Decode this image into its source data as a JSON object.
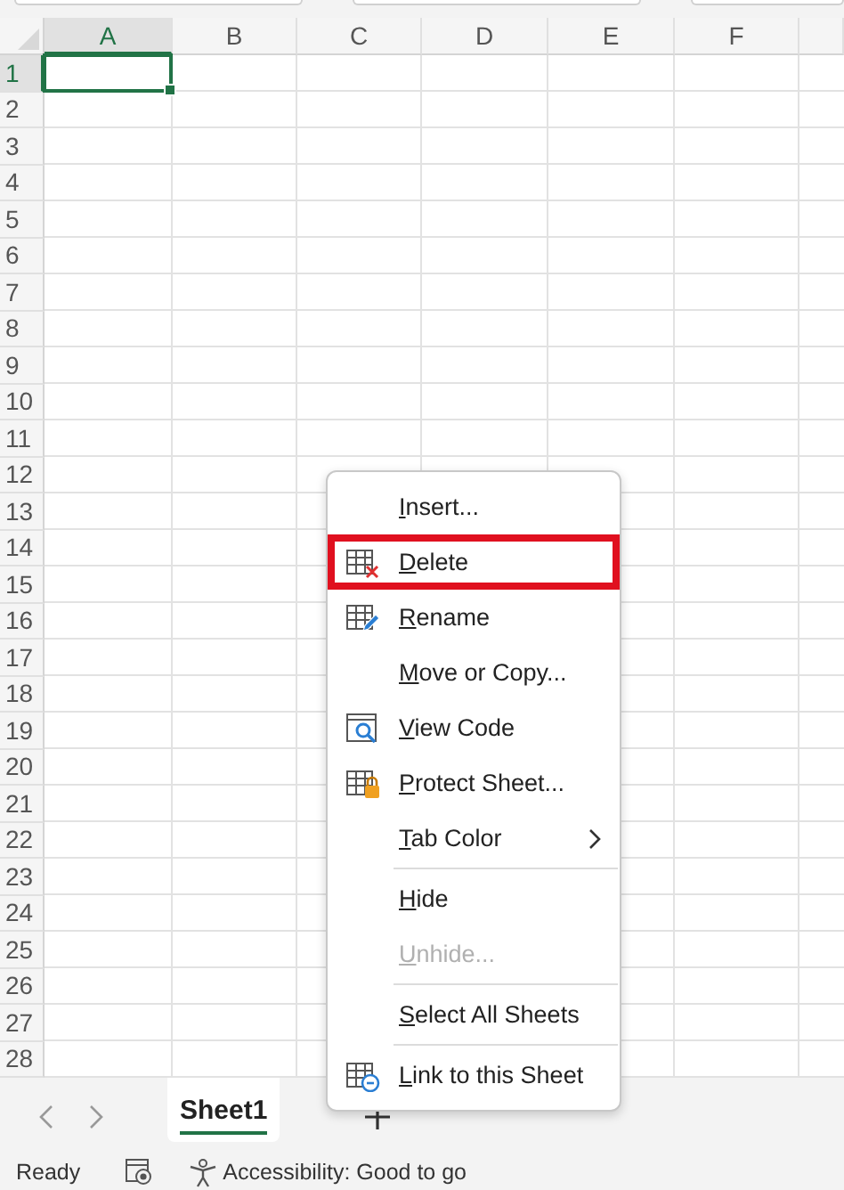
{
  "columns": [
    {
      "label": "A",
      "selected": true
    },
    {
      "label": "B",
      "selected": false
    },
    {
      "label": "C",
      "selected": false
    },
    {
      "label": "D",
      "selected": false
    },
    {
      "label": "E",
      "selected": false
    },
    {
      "label": "F",
      "selected": false
    }
  ],
  "rows": [
    {
      "label": "1",
      "selected": true
    },
    {
      "label": "2",
      "selected": false
    },
    {
      "label": "3",
      "selected": false
    },
    {
      "label": "4",
      "selected": false
    },
    {
      "label": "5",
      "selected": false
    },
    {
      "label": "6",
      "selected": false
    },
    {
      "label": "7",
      "selected": false
    },
    {
      "label": "8",
      "selected": false
    },
    {
      "label": "9",
      "selected": false
    },
    {
      "label": "10",
      "selected": false
    },
    {
      "label": "11",
      "selected": false
    },
    {
      "label": "12",
      "selected": false
    },
    {
      "label": "13",
      "selected": false
    },
    {
      "label": "14",
      "selected": false
    },
    {
      "label": "15",
      "selected": false
    },
    {
      "label": "16",
      "selected": false
    },
    {
      "label": "17",
      "selected": false
    },
    {
      "label": "18",
      "selected": false
    },
    {
      "label": "19",
      "selected": false
    },
    {
      "label": "20",
      "selected": false
    },
    {
      "label": "21",
      "selected": false
    },
    {
      "label": "22",
      "selected": false
    },
    {
      "label": "23",
      "selected": false
    },
    {
      "label": "24",
      "selected": false
    },
    {
      "label": "25",
      "selected": false
    },
    {
      "label": "26",
      "selected": false
    },
    {
      "label": "27",
      "selected": false
    },
    {
      "label": "28",
      "selected": false
    }
  ],
  "context_menu": {
    "items": [
      {
        "label": "Insert...",
        "kind": "plain",
        "disabled": false,
        "submenu": false,
        "separator_before": false,
        "highlighted": false
      },
      {
        "label": "Delete",
        "kind": "delete",
        "disabled": false,
        "submenu": false,
        "separator_before": false,
        "highlighted": true
      },
      {
        "label": "Rename",
        "kind": "rename",
        "disabled": false,
        "submenu": false,
        "separator_before": false,
        "highlighted": false
      },
      {
        "label": "Move or Copy...",
        "kind": "plain",
        "disabled": false,
        "submenu": false,
        "separator_before": false,
        "highlighted": false
      },
      {
        "label": "View Code",
        "kind": "code",
        "disabled": false,
        "submenu": false,
        "separator_before": false,
        "highlighted": false
      },
      {
        "label": "Protect Sheet...",
        "kind": "protect",
        "disabled": false,
        "submenu": false,
        "separator_before": false,
        "highlighted": false
      },
      {
        "label": "Tab Color",
        "kind": "plain",
        "disabled": false,
        "submenu": true,
        "separator_before": false,
        "highlighted": false
      },
      {
        "label": "Hide",
        "kind": "plain",
        "disabled": false,
        "submenu": false,
        "separator_before": true,
        "highlighted": false
      },
      {
        "label": "Unhide...",
        "kind": "plain",
        "disabled": true,
        "submenu": false,
        "separator_before": false,
        "highlighted": false
      },
      {
        "label": "Select All Sheets",
        "kind": "plain",
        "disabled": false,
        "submenu": false,
        "separator_before": true,
        "highlighted": false
      },
      {
        "label": "Link to this Sheet",
        "kind": "link",
        "disabled": false,
        "submenu": false,
        "separator_before": true,
        "highlighted": false
      }
    ]
  },
  "sheet_tabs": [
    {
      "name": "Sheet1",
      "selected": true
    }
  ],
  "status_bar": {
    "status": "Ready",
    "accessibility": "Accessibility: Good to go"
  }
}
